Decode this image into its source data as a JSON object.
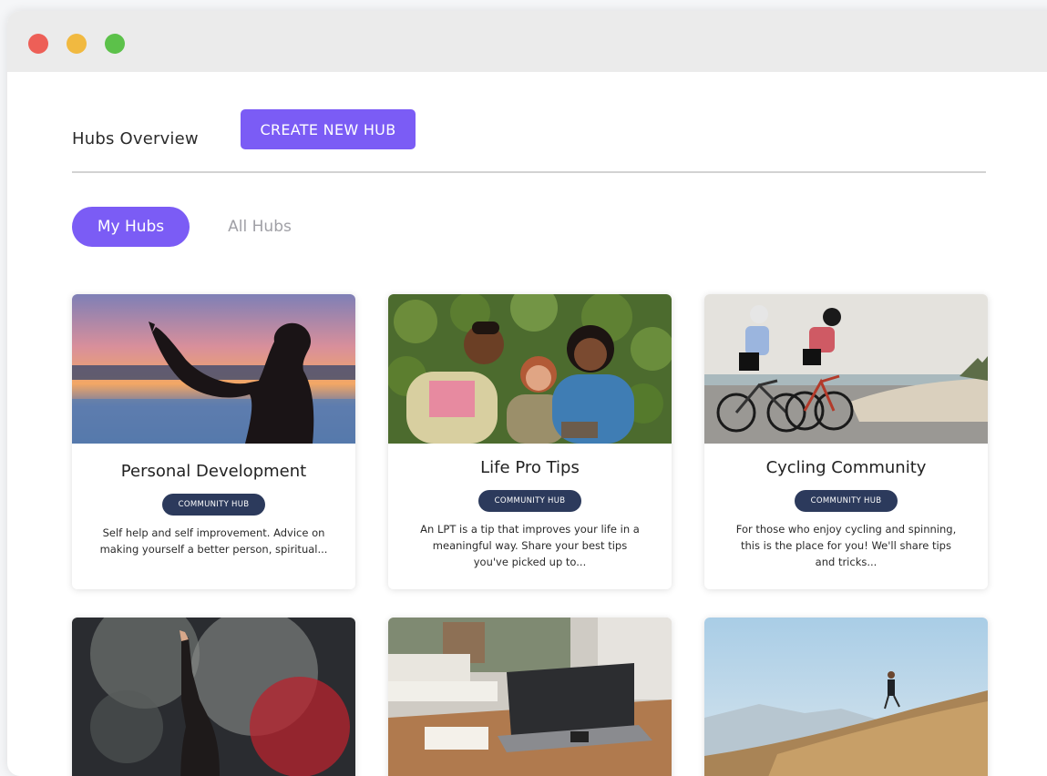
{
  "window": {
    "controls": [
      "close",
      "minimize",
      "maximize"
    ]
  },
  "header": {
    "title": "Hubs Overview",
    "create_button": "CREATE NEW HUB"
  },
  "tabs": [
    {
      "label": "My Hubs",
      "active": true
    },
    {
      "label": "All Hubs",
      "active": false
    }
  ],
  "hubs": [
    {
      "title": "Personal Development",
      "badge": "COMMUNITY HUB",
      "description": "Self help and self improvement. Advice on making yourself a better person, spiritual...",
      "image": "silhouette-sunset-photo"
    },
    {
      "title": "Life Pro Tips",
      "badge": "COMMUNITY HUB",
      "description": "An LPT is a tip that improves your life in a meaningful way. Share your best tips you've picked up to...",
      "image": "friends-laughing-photo"
    },
    {
      "title": "Cycling Community",
      "badge": "COMMUNITY HUB",
      "description": "For those who enjoy cycling and spinning, this is the place for you! We'll share tips and tricks...",
      "image": "cyclists-beach-photo"
    },
    {
      "image": "concert-dancer-photo"
    },
    {
      "image": "desk-laptop-photo"
    },
    {
      "image": "hill-runner-photo"
    }
  ],
  "colors": {
    "accent": "#7b5cf5",
    "badge": "#2c3a5c",
    "titlebar": "#ebebeb"
  }
}
